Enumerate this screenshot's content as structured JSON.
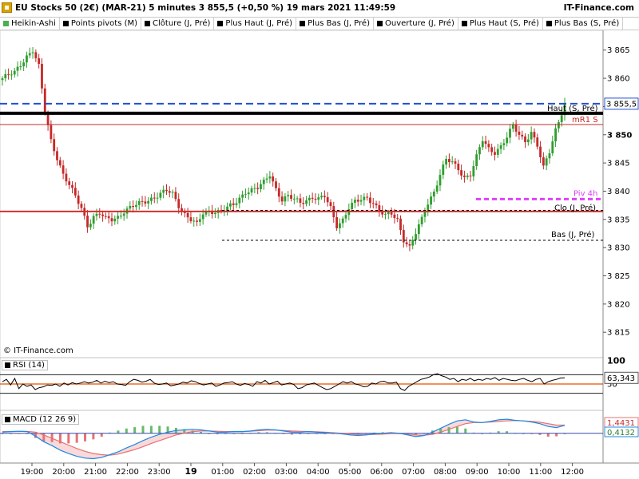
{
  "title": {
    "text": "EU Stocks 50 (2€) (MAR-21) 5 minutes 3 855,5 (+0,50 %) 19 mars 2021 11:49:59",
    "brand": "IT-Finance.com"
  },
  "indicator_bar": [
    {
      "label": "Heikin-Ashi",
      "swatch": "green"
    },
    {
      "label": "Points pivots (M)",
      "swatch": "black"
    },
    {
      "label": "Clôture (J, Pré)",
      "swatch": "black"
    },
    {
      "label": "Plus Haut (J, Pré)",
      "swatch": "black"
    },
    {
      "label": "Plus Bas (J, Pré)",
      "swatch": "black"
    },
    {
      "label": "Ouverture (J, Pré)",
      "swatch": "black"
    },
    {
      "label": "Plus Haut (S, Pré)",
      "swatch": "black"
    },
    {
      "label": "Plus Bas (S, Pré)",
      "swatch": "black"
    }
  ],
  "watermark": "© IT-Finance.com",
  "colors": {
    "up": "#2e9e2e",
    "down": "#c62828",
    "weekly_high": "#1f4fd6",
    "pivot": "#e040fb",
    "rsi_level": "#e65100",
    "macd_signal": "#e57373",
    "macd_line": "#1e88e5"
  },
  "chart_data": {
    "type": "candlestick",
    "price_axis": {
      "ylim": [
        3810.5,
        3868.5
      ],
      "ticks": [
        3815,
        3820,
        3825,
        3830,
        3835,
        3840,
        3845,
        3850,
        3855,
        3860,
        3865
      ],
      "tick_labels": [
        "3 815",
        "3 820",
        "3 825",
        "3 830",
        "3 835",
        "3 840",
        "3 845",
        "3 850",
        "3 855",
        "3 860",
        "3 865"
      ],
      "bold_tick": 3850
    },
    "time_axis": {
      "labels": [
        "19:00",
        "20:00",
        "21:00",
        "22:00",
        "23:00",
        "19",
        "01:00",
        "02:00",
        "03:00",
        "04:00",
        "05:00",
        "06:00",
        "07:00",
        "08:00",
        "09:00",
        "10:00",
        "11:00",
        "12:00"
      ],
      "bold_label": "19"
    },
    "anchors": [
      [
        0,
        3860
      ],
      [
        4,
        3861
      ],
      [
        8,
        3864
      ],
      [
        10,
        3865
      ],
      [
        12,
        3862
      ],
      [
        14,
        3854
      ],
      [
        16,
        3849
      ],
      [
        18,
        3846
      ],
      [
        20,
        3843
      ],
      [
        22,
        3841
      ],
      [
        24,
        3839
      ],
      [
        26,
        3837
      ],
      [
        28,
        3834
      ],
      [
        30,
        3835.5
      ],
      [
        32,
        3836
      ],
      [
        34,
        3835
      ],
      [
        36,
        3835
      ],
      [
        38,
        3835.5
      ],
      [
        40,
        3836.5
      ],
      [
        44,
        3837.5
      ],
      [
        48,
        3838.5
      ],
      [
        52,
        3839.5
      ],
      [
        54,
        3840
      ],
      [
        56,
        3839.5
      ],
      [
        58,
        3837.5
      ],
      [
        60,
        3836
      ],
      [
        62,
        3835
      ],
      [
        64,
        3834
      ],
      [
        66,
        3836
      ],
      [
        68,
        3836.5
      ],
      [
        72,
        3836.5
      ],
      [
        76,
        3837.5
      ],
      [
        80,
        3840
      ],
      [
        84,
        3840.5
      ],
      [
        86,
        3841.5
      ],
      [
        88,
        3843
      ],
      [
        90,
        3840.5
      ],
      [
        92,
        3838.5
      ],
      [
        94,
        3839
      ],
      [
        96,
        3838.5
      ],
      [
        98,
        3838
      ],
      [
        100,
        3838.5
      ],
      [
        102,
        3839
      ],
      [
        104,
        3838.5
      ],
      [
        106,
        3839
      ],
      [
        108,
        3837
      ],
      [
        110,
        3834
      ],
      [
        112,
        3835
      ],
      [
        114,
        3837
      ],
      [
        116,
        3838
      ],
      [
        118,
        3838.5
      ],
      [
        120,
        3839
      ],
      [
        122,
        3838
      ],
      [
        124,
        3836.5
      ],
      [
        126,
        3835.5
      ],
      [
        128,
        3836
      ],
      [
        130,
        3835
      ],
      [
        132,
        3831.5
      ],
      [
        134,
        3830
      ],
      [
        136,
        3832.5
      ],
      [
        138,
        3835
      ],
      [
        140,
        3838
      ],
      [
        142,
        3840
      ],
      [
        144,
        3843
      ],
      [
        146,
        3845.5
      ],
      [
        148,
        3845
      ],
      [
        150,
        3844
      ],
      [
        152,
        3842.5
      ],
      [
        154,
        3843
      ],
      [
        156,
        3846
      ],
      [
        158,
        3849
      ],
      [
        160,
        3847.5
      ],
      [
        162,
        3847
      ],
      [
        164,
        3848
      ],
      [
        166,
        3849.5
      ],
      [
        168,
        3851.5
      ],
      [
        170,
        3850
      ],
      [
        172,
        3849
      ],
      [
        174,
        3850.5
      ],
      [
        176,
        3848
      ],
      [
        178,
        3844
      ],
      [
        180,
        3847
      ],
      [
        182,
        3851
      ],
      [
        184,
        3854
      ],
      [
        185,
        3855.5
      ]
    ],
    "levels": [
      {
        "label": "Haut (S, Pré)",
        "value": 3853.8,
        "style": "thick-black"
      },
      {
        "label": "",
        "value": 3855.5,
        "style": "dashed-blue"
      },
      {
        "label": "mR1 S",
        "value": 3851.8,
        "style": "thin-red"
      },
      {
        "label": "Piv 4h",
        "value": 3838.6,
        "style": "dashed-magenta"
      },
      {
        "label": "Clo (J, Pré)",
        "value": 3836.6,
        "style": "dashed-black"
      },
      {
        "label": "",
        "value": 3836.4,
        "style": "red"
      },
      {
        "label": "Bas (J, Pré)",
        "value": 3831.3,
        "style": "dashed-black"
      }
    ],
    "last_price": {
      "value": 3855.5,
      "label": "3 855,5"
    },
    "rsi": {
      "name": "RSI (14)",
      "ticks": [
        {
          "value": 100,
          "label": "100"
        },
        {
          "value": 50,
          "label": "50"
        }
      ],
      "levels": [
        70,
        50,
        30
      ],
      "value_label": "63,343",
      "values": [
        55,
        60,
        48,
        62,
        40,
        50,
        45,
        48,
        38,
        42,
        44,
        48,
        47,
        50,
        45,
        52,
        48,
        53,
        50,
        52,
        55,
        52,
        54,
        58,
        52,
        56,
        53,
        55,
        50,
        49,
        47,
        55,
        60,
        58,
        54,
        56,
        60,
        52,
        49,
        50,
        52,
        46,
        48,
        50,
        54,
        52,
        57,
        55,
        51,
        48,
        50,
        52,
        45,
        48,
        52,
        53,
        55,
        50,
        47,
        51,
        49,
        45,
        55,
        52,
        58,
        50,
        53,
        56,
        48,
        50,
        52,
        49,
        40,
        42,
        48,
        50,
        52,
        47,
        42,
        38,
        40,
        45,
        50,
        55,
        52,
        55,
        50,
        48,
        44,
        45,
        52,
        50,
        55,
        56,
        52,
        52,
        54,
        40,
        36,
        45,
        50,
        55,
        60,
        62,
        65,
        70,
        72,
        68,
        65,
        60,
        62,
        55,
        60,
        58,
        62,
        57,
        60,
        58,
        62,
        60,
        64,
        58,
        62,
        60,
        58,
        57,
        60,
        62,
        58,
        55,
        60,
        62,
        50,
        55,
        58,
        60,
        63,
        63.3
      ]
    },
    "macd": {
      "name": "MACD (12 26 9)",
      "params": "(12 26 9)",
      "signal_label": "1,4431",
      "histogram_label": "0,4132",
      "macd_values": [
        0.2,
        0.3,
        0.35,
        0.3,
        -0.5,
        -1.5,
        -2.2,
        -3.0,
        -3.6,
        -4.1,
        -4.4,
        -4.5,
        -4.3,
        -3.8,
        -3.3,
        -2.6,
        -2.0,
        -1.3,
        -0.7,
        -0.2,
        0.2,
        0.5,
        0.6,
        0.7,
        0.6,
        0.4,
        0.2,
        0.2,
        0.3,
        0.3,
        0.4,
        0.6,
        0.7,
        0.6,
        0.4,
        0.2,
        0.2,
        0.3,
        0.2,
        0.1,
        0.0,
        -0.1,
        -0.3,
        -0.4,
        -0.3,
        -0.1,
        0.0,
        0.1,
        0.0,
        -0.3,
        -0.6,
        -0.4,
        0.2,
        0.9,
        1.6,
        2.2,
        2.4,
        2.0,
        1.9,
        2.1,
        2.4,
        2.5,
        2.3,
        2.2,
        2.0,
        1.7,
        1.2,
        1.0,
        1.4
      ],
      "signal_values": [
        0.3,
        0.3,
        0.32,
        0.33,
        0.2,
        -0.3,
        -0.9,
        -1.5,
        -2.1,
        -2.7,
        -3.2,
        -3.6,
        -3.8,
        -3.9,
        -3.7,
        -3.3,
        -2.9,
        -2.4,
        -1.8,
        -1.3,
        -0.8,
        -0.3,
        0.0,
        0.3,
        0.4,
        0.4,
        0.35,
        0.3,
        0.3,
        0.3,
        0.35,
        0.45,
        0.55,
        0.55,
        0.5,
        0.4,
        0.35,
        0.3,
        0.25,
        0.2,
        0.1,
        0.0,
        -0.1,
        -0.2,
        -0.25,
        -0.2,
        -0.15,
        -0.05,
        -0.05,
        -0.15,
        -0.3,
        -0.35,
        -0.2,
        0.2,
        0.7,
        1.2,
        1.7,
        1.9,
        1.9,
        2.0,
        2.1,
        2.2,
        2.25,
        2.2,
        2.1,
        1.95,
        1.7,
        1.45,
        1.44
      ],
      "ylim": [
        -5,
        3.5
      ]
    }
  }
}
